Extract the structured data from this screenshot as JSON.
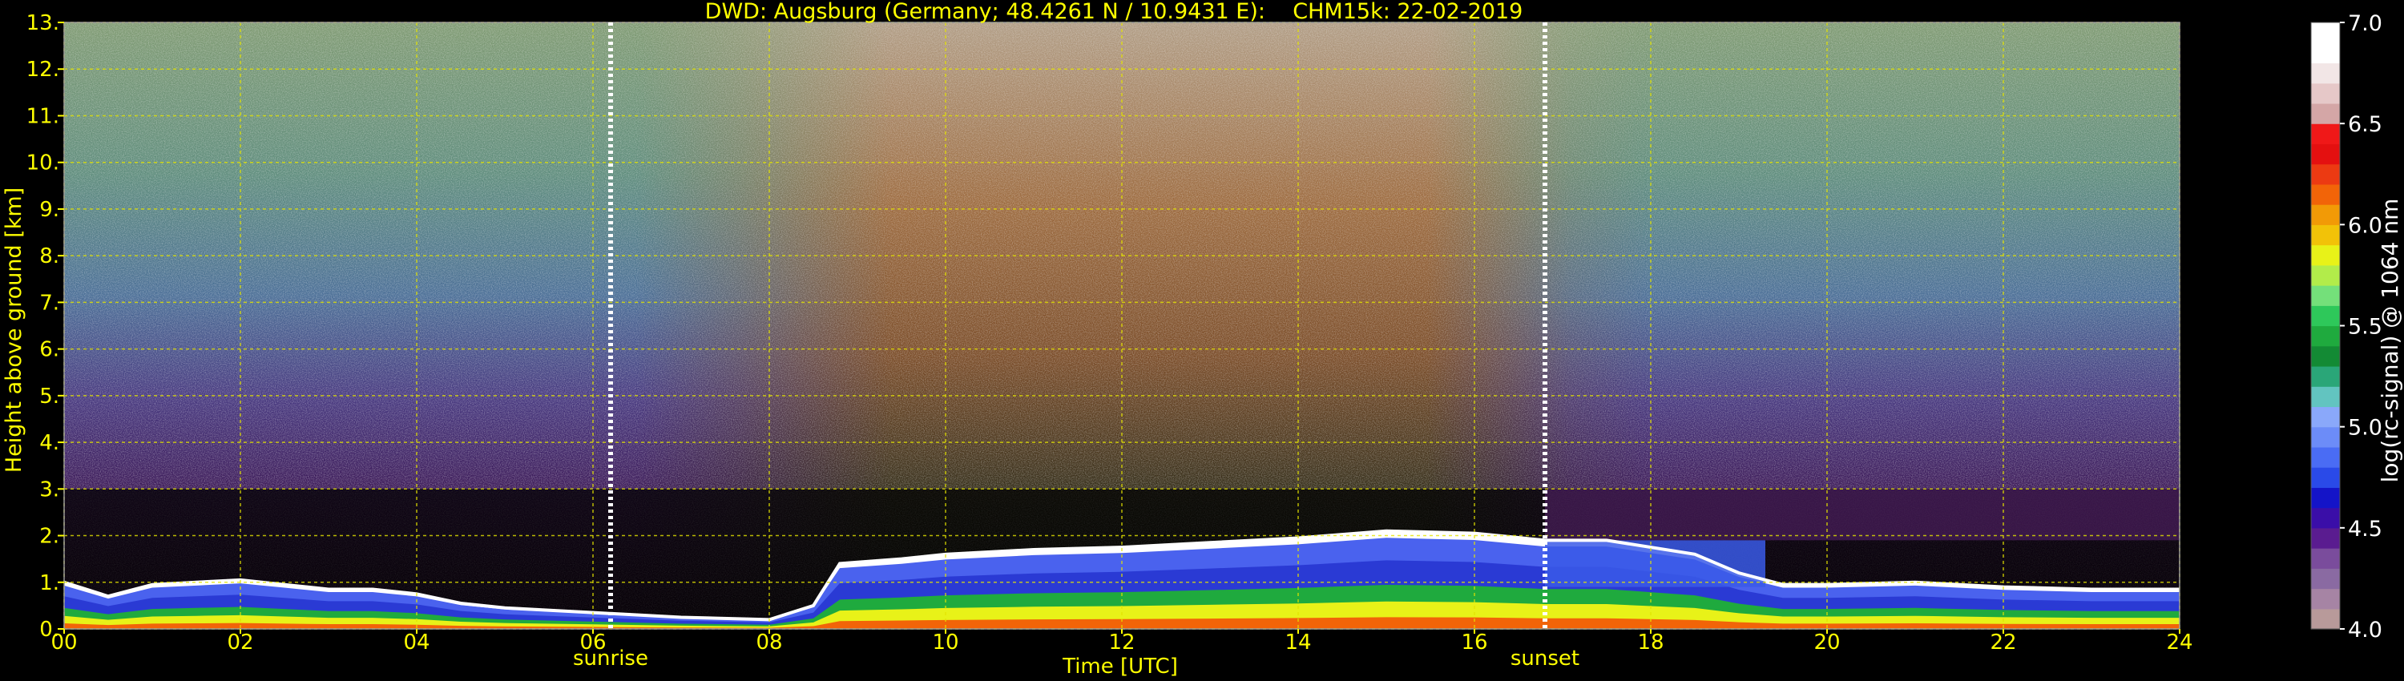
{
  "chart_data": {
    "type": "heatmap",
    "title": "DWD: Augsburg (Germany; 48.4261 N / 10.9431 E):    CHM15k: 22-02-2019",
    "xlabel": "Time [UTC]",
    "ylabel": "Height above ground [km]",
    "xlim": [
      0,
      24
    ],
    "ylim": [
      0,
      13
    ],
    "x_ticks": [
      "00",
      "02",
      "04",
      "06",
      "08",
      "10",
      "12",
      "14",
      "16",
      "18",
      "20",
      "22",
      "24"
    ],
    "y_ticks": [
      "0.",
      "1.",
      "2.",
      "3.",
      "4.",
      "5.",
      "6.",
      "7.",
      "8.",
      "9.",
      "10.",
      "11.",
      "12.",
      "13."
    ],
    "grid": true,
    "markers": [
      {
        "label": "sunrise",
        "time_h": 6.2
      },
      {
        "label": "sunset",
        "time_h": 16.8
      }
    ],
    "colorbar": {
      "label": "log(rc-signal) @ 1064 nm",
      "range": [
        4.0,
        7.0
      ],
      "ticks": [
        "4.0",
        "4.5",
        "5.0",
        "5.5",
        "6.0",
        "6.5",
        "7.0"
      ],
      "colors": [
        "#b89a9a",
        "#a684a4",
        "#8a6aa2",
        "#7a4c9c",
        "#5a1c90",
        "#3a0ea8",
        "#1414c8",
        "#2a4ae8",
        "#4a6cf4",
        "#6c8cf8",
        "#8aa8fa",
        "#62c4c0",
        "#2aa678",
        "#138a34",
        "#1faa3e",
        "#2ec85a",
        "#74e07a",
        "#b2ec4a",
        "#e8f218",
        "#f2c208",
        "#f29a06",
        "#f26408",
        "#ec3a12",
        "#e41010",
        "#f01818",
        "#d4a6a6",
        "#e6c8c8",
        "#f2e6e6",
        "#ffffff",
        "#ffffff"
      ]
    },
    "profile": {
      "pbl_top_km": [
        [
          0,
          1.0
        ],
        [
          0.5,
          0.7
        ],
        [
          1,
          0.95
        ],
        [
          1.5,
          1.0
        ],
        [
          2,
          1.05
        ],
        [
          2.5,
          0.95
        ],
        [
          3,
          0.85
        ],
        [
          3.5,
          0.85
        ],
        [
          4,
          0.75
        ],
        [
          4.5,
          0.55
        ],
        [
          5,
          0.45
        ],
        [
          6,
          0.35
        ],
        [
          7,
          0.25
        ],
        [
          8,
          0.2
        ],
        [
          8.5,
          0.5
        ],
        [
          8.8,
          1.4
        ],
        [
          9.5,
          1.5
        ],
        [
          10,
          1.6
        ],
        [
          11,
          1.7
        ],
        [
          12,
          1.75
        ],
        [
          13,
          1.85
        ],
        [
          14,
          1.95
        ],
        [
          15,
          2.1
        ],
        [
          16,
          2.05
        ],
        [
          16.8,
          1.9
        ],
        [
          17.5,
          1.9
        ],
        [
          18.5,
          1.6
        ],
        [
          19,
          1.2
        ],
        [
          19.5,
          0.95
        ],
        [
          20,
          0.95
        ],
        [
          21,
          1.0
        ],
        [
          22,
          0.9
        ],
        [
          23,
          0.85
        ],
        [
          24,
          0.85
        ]
      ],
      "residual_layer": {
        "start_h": 16.8,
        "end_h": 19.3,
        "top_km": 1.9,
        "base_km": 0.9
      },
      "upper_noise": {
        "day_start_h": 8.0,
        "day_end_h": 16.5
      }
    }
  }
}
